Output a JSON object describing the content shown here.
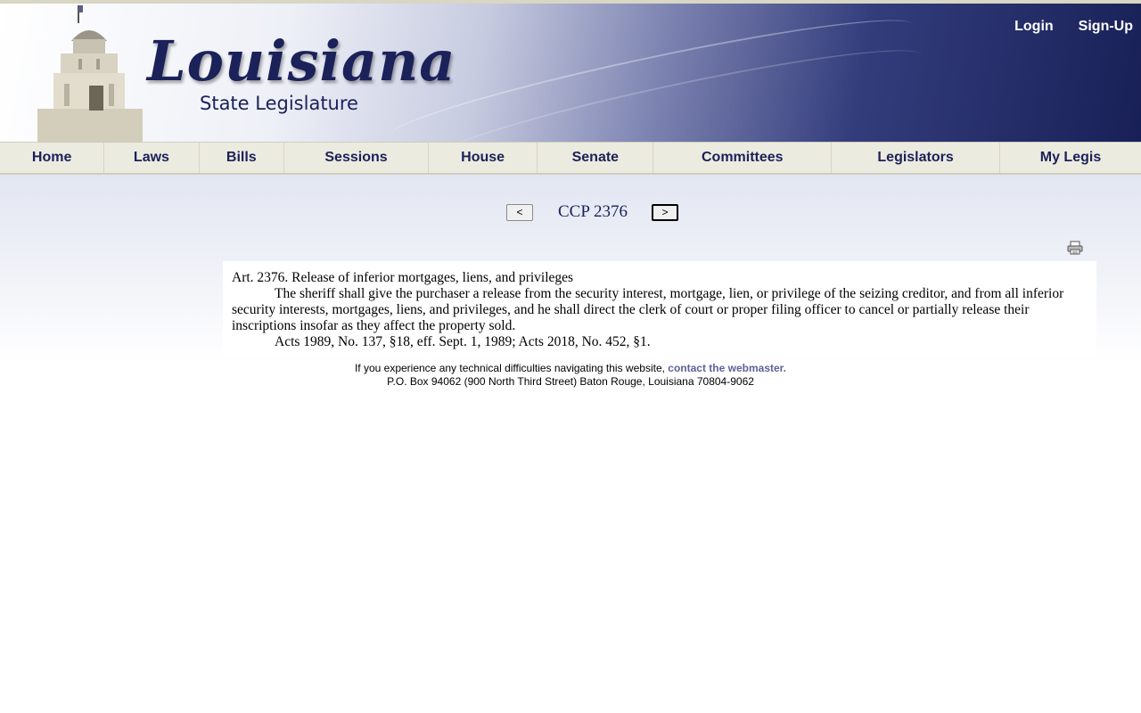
{
  "header": {
    "logo_title": "Louisiana",
    "logo_subtitle": "State Legislature",
    "login_label": "Login",
    "signup_label": "Sign-Up"
  },
  "nav": {
    "items": [
      "Home",
      "Laws",
      "Bills",
      "Sessions",
      "House",
      "Senate",
      "Committees",
      "Legislators",
      "My Legis"
    ]
  },
  "pager": {
    "prev_label": "<",
    "title": "CCP 2376",
    "next_label": ">"
  },
  "law": {
    "heading": "Art. 2376. Release of inferior mortgages, liens, and privileges",
    "body": "The sheriff shall give the purchaser a release from the security interest, mortgage, lien, or privilege of the seizing creditor, and from all inferior security interests, mortgages, liens, and privileges, and he shall direct the clerk of court or proper filing officer to cancel or partially release their inscriptions insofar as they affect the property sold.",
    "history": "Acts 1989, No. 137, §18, eff. Sept. 1, 1989; Acts 2018, No. 452, §1."
  },
  "footer": {
    "line1": "If you experience any technical difficulties navigating this website,",
    "link": "contact the webmaster.",
    "line2": "P.O. Box 94062 (900 North Third Street) Baton Rouge, Louisiana 70804-9062"
  },
  "colors": {
    "brand_navy": "#1b2159",
    "nav_bg": "#ecebe0",
    "link": "#5b6399"
  }
}
